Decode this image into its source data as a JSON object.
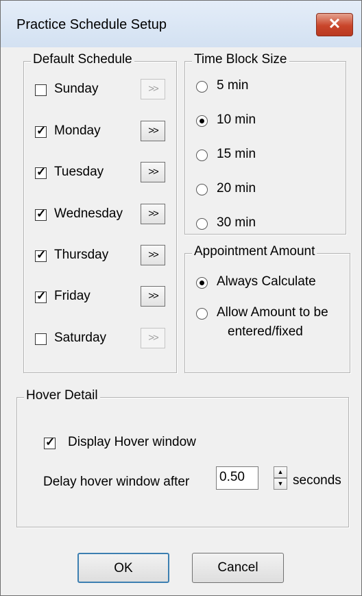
{
  "window": {
    "title": "Practice Schedule Setup",
    "close_glyph": "✕"
  },
  "default_schedule": {
    "legend": "Default Schedule",
    "arrow_label": ">>",
    "days": [
      {
        "label": "Sunday",
        "checked": false
      },
      {
        "label": "Monday",
        "checked": true
      },
      {
        "label": "Tuesday",
        "checked": true
      },
      {
        "label": "Wednesday",
        "checked": true
      },
      {
        "label": "Thursday",
        "checked": true
      },
      {
        "label": "Friday",
        "checked": true
      },
      {
        "label": "Saturday",
        "checked": false
      }
    ]
  },
  "time_block": {
    "legend": "Time Block Size",
    "options": [
      "5 min",
      "10 min",
      "15 min",
      "20 min",
      "30 min"
    ],
    "selected": "10 min"
  },
  "appointment_amount": {
    "legend": "Appointment Amount",
    "option1": "Always Calculate",
    "option2_line1": "Allow Amount to be",
    "option2_line2": "entered/fixed",
    "selected": "Always Calculate"
  },
  "hover_detail": {
    "legend": "Hover Detail",
    "display_label": "Display Hover window",
    "display_checked": true,
    "delay_label": "Delay hover window after",
    "delay_value": "0.50",
    "unit": "seconds"
  },
  "buttons": {
    "ok": "OK",
    "cancel": "Cancel"
  }
}
